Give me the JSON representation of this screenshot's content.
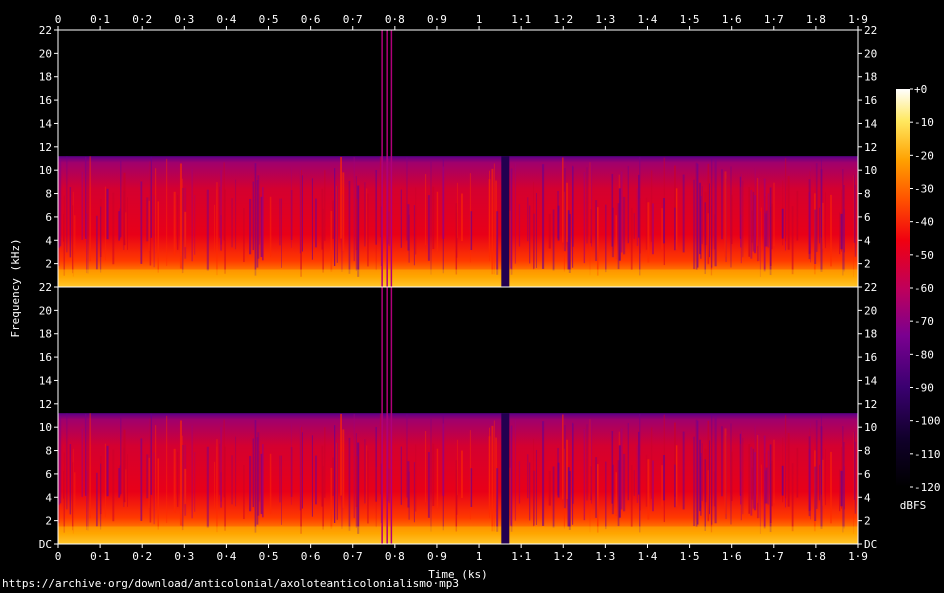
{
  "chart_data": {
    "type": "heatmap",
    "subtype": "spectrogram",
    "channels": 2,
    "xlabel": "Time (ks)",
    "ylabel": "Frequency (kHz)",
    "xlim": [
      0,
      1.9
    ],
    "ylim": [
      0,
      22
    ],
    "x_ticks": [
      "0",
      "0·1",
      "0·2",
      "0·3",
      "0·4",
      "0·5",
      "0·6",
      "0·7",
      "0·8",
      "0·9",
      "1",
      "1·1",
      "1·2",
      "1·3",
      "1·4",
      "1·5",
      "1·6",
      "1·7",
      "1·8",
      "1·9"
    ],
    "y_ticks_top": [
      "2",
      "4",
      "6",
      "8",
      "10",
      "12",
      "14",
      "16",
      "18",
      "20",
      "22"
    ],
    "y_ticks_bottom": [
      "DC",
      "2",
      "4",
      "6",
      "8",
      "10",
      "12",
      "14",
      "16",
      "18",
      "20",
      "22"
    ],
    "colorbar": {
      "label": "dBFS",
      "range": [
        -120,
        0
      ],
      "ticks": [
        "+0",
        "-10",
        "-20",
        "-30",
        "-40",
        "-50",
        "-60",
        "-70",
        "-80",
        "-90",
        "-100",
        "-110",
        "-120"
      ],
      "colors": [
        "#000000",
        "#1a0040",
        "#5a0088",
        "#a0006c",
        "#e00020",
        "#ff4a00",
        "#ffa400",
        "#ffe04a",
        "#ffffff"
      ]
    },
    "observations": {
      "cutoff_khz": 11.2,
      "narrow_dip_near_ks": 1.06,
      "spike_lines_ks": [
        0.768,
        0.78,
        0.79
      ]
    }
  },
  "source_url": "https://archive·org/download/anticolonial/axoloteanticolonialismo·mp3"
}
